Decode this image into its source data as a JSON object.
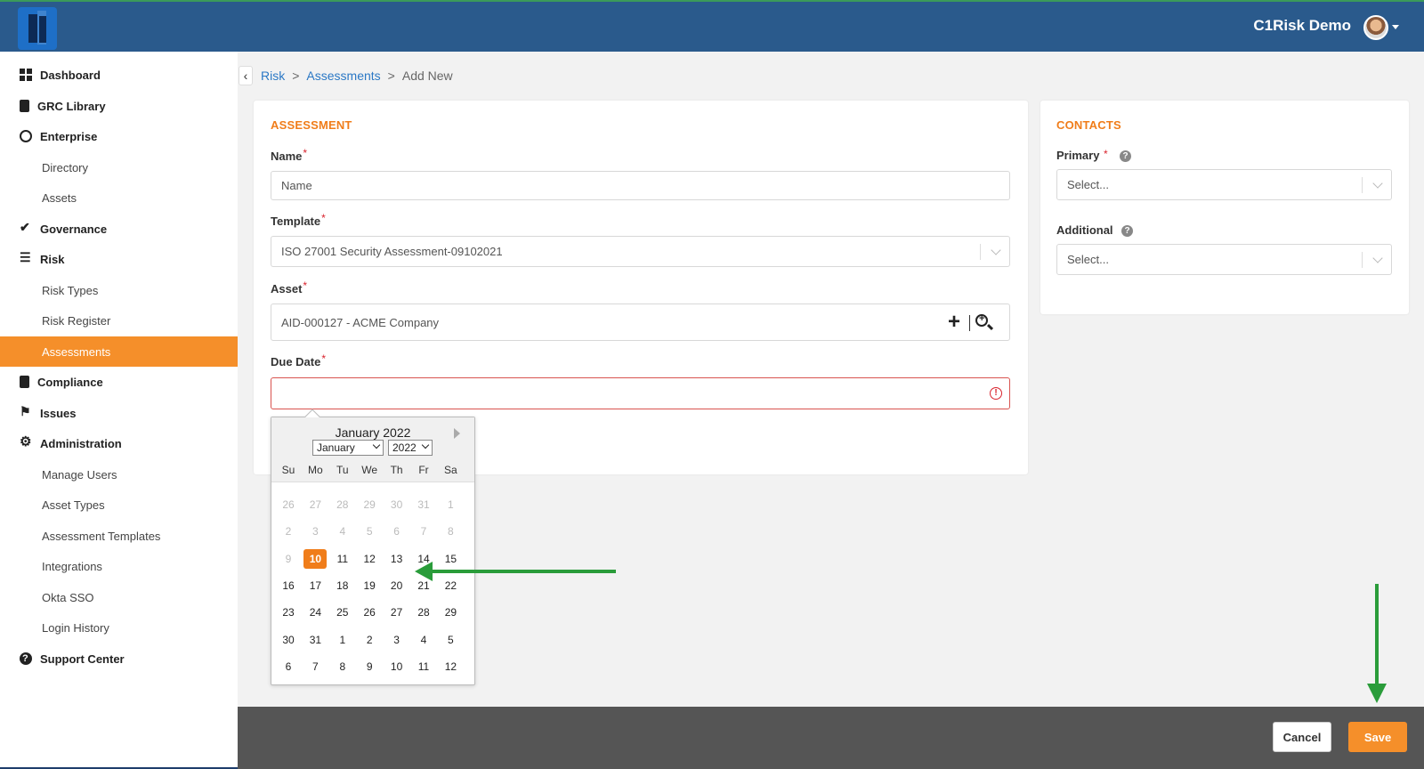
{
  "header": {
    "user_name": "C1Risk Demo",
    "logo_icon": "c1risk-logo",
    "avatar_icon": "user-avatar"
  },
  "sidebar": {
    "items": [
      {
        "label": "Dashboard",
        "level": "top",
        "icon": "dashboard-icon"
      },
      {
        "label": "GRC Library",
        "level": "top",
        "icon": "book-icon"
      },
      {
        "label": "Enterprise",
        "level": "top",
        "icon": "globe-icon"
      },
      {
        "label": "Directory",
        "level": "sub"
      },
      {
        "label": "Assets",
        "level": "sub"
      },
      {
        "label": "Governance",
        "level": "top",
        "icon": "check-icon"
      },
      {
        "label": "Risk",
        "level": "top",
        "icon": "list-icon"
      },
      {
        "label": "Risk Types",
        "level": "sub"
      },
      {
        "label": "Risk Register",
        "level": "sub"
      },
      {
        "label": "Assessments",
        "level": "sub",
        "active": true
      },
      {
        "label": "Compliance",
        "level": "top",
        "icon": "clipboard-icon"
      },
      {
        "label": "Issues",
        "level": "top",
        "icon": "flag-icon"
      },
      {
        "label": "Administration",
        "level": "top",
        "icon": "gear-icon"
      },
      {
        "label": "Manage Users",
        "level": "sub"
      },
      {
        "label": "Asset Types",
        "level": "sub"
      },
      {
        "label": "Assessment Templates",
        "level": "sub"
      },
      {
        "label": "Integrations",
        "level": "sub"
      },
      {
        "label": "Okta SSO",
        "level": "sub"
      },
      {
        "label": "Login History",
        "level": "sub"
      },
      {
        "label": "Support Center",
        "level": "top",
        "icon": "help-icon"
      }
    ],
    "active_color": "#f58f2a"
  },
  "breadcrumb": {
    "items": [
      "Risk",
      "Assessments",
      "Add New"
    ],
    "separator": ">"
  },
  "assessment": {
    "title": "ASSESSMENT",
    "name_label": "Name",
    "name_placeholder": "Name",
    "template_label": "Template",
    "template_value": "ISO 27001 Security Assessment-09102021",
    "asset_label": "Asset",
    "asset_value": "AID-000127 - ACME Company",
    "due_date_label": "Due Date",
    "required_mark": "*"
  },
  "contacts": {
    "title": "CONTACTS",
    "primary_label": "Primary",
    "primary_placeholder": "Select...",
    "additional_label": "Additional",
    "additional_placeholder": "Select...",
    "required_mark": "*"
  },
  "datepicker": {
    "title": "January 2022",
    "month_select": "January",
    "year_select": "2022",
    "weekdays": [
      "Su",
      "Mo",
      "Tu",
      "We",
      "Th",
      "Fr",
      "Sa"
    ],
    "weeks": [
      [
        "26",
        "27",
        "28",
        "29",
        "30",
        "31",
        "1"
      ],
      [
        "2",
        "3",
        "4",
        "5",
        "6",
        "7",
        "8"
      ],
      [
        "9",
        "10",
        "11",
        "12",
        "13",
        "14",
        "15"
      ],
      [
        "16",
        "17",
        "18",
        "19",
        "20",
        "21",
        "22"
      ],
      [
        "23",
        "24",
        "25",
        "26",
        "27",
        "28",
        "29"
      ],
      [
        "30",
        "31",
        "1",
        "2",
        "3",
        "4",
        "5"
      ],
      [
        "6",
        "7",
        "8",
        "9",
        "10",
        "11",
        "12"
      ]
    ],
    "muted_cells": [
      [
        0,
        0
      ],
      [
        0,
        1
      ],
      [
        0,
        2
      ],
      [
        0,
        3
      ],
      [
        0,
        4
      ],
      [
        0,
        5
      ],
      [
        0,
        6
      ],
      [
        1,
        0
      ],
      [
        1,
        1
      ],
      [
        1,
        2
      ],
      [
        1,
        3
      ],
      [
        1,
        4
      ],
      [
        1,
        5
      ],
      [
        1,
        6
      ],
      [
        2,
        0
      ]
    ],
    "selected_cell": [
      2,
      1
    ],
    "selected_color": "#f07d1a"
  },
  "footer": {
    "cancel_label": "Cancel",
    "save_label": "Save"
  },
  "colors": {
    "header_bg": "#2a5a8c",
    "accent": "#f58f2a",
    "link": "#2b78c5",
    "section_title": "#f07d1a",
    "annotation_arrow": "#2a9c3a"
  }
}
